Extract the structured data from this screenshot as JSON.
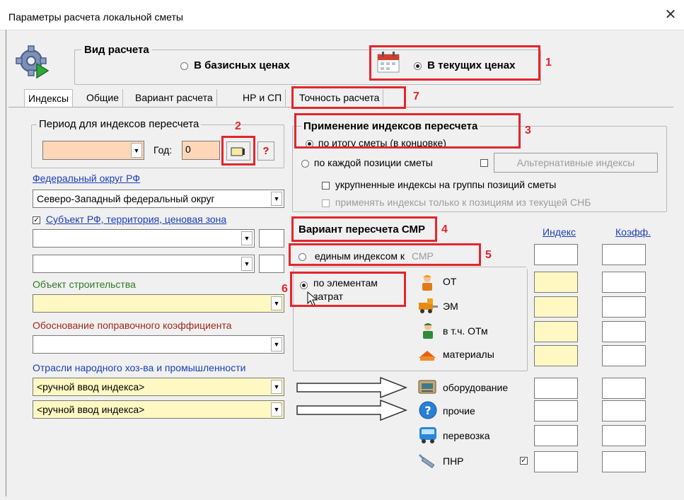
{
  "window": {
    "title": "Параметры расчета локальной сметы",
    "close": "✕"
  },
  "calc_type": {
    "label": "Вид расчета",
    "option_base": "В базисных ценах",
    "option_current": "В текущих ценах",
    "badge": "1"
  },
  "tabs": [
    {
      "label": "Индексы"
    },
    {
      "label": "Общие"
    },
    {
      "label": "Вариант расчета"
    },
    {
      "label": "НР и СП"
    },
    {
      "label": "Точность расчета"
    }
  ],
  "tab_badge": "7",
  "period": {
    "label": "Период для индексов пересчета",
    "year_label": "Год:",
    "year_value": "0",
    "help": "?",
    "badge": "2"
  },
  "federal": {
    "label": "Федеральный округ РФ",
    "value": "Северо-Западный федеральный округ"
  },
  "subject": {
    "label": "Субъект РФ, территория, ценовая зона"
  },
  "object": {
    "label": "Объект строительства"
  },
  "justification": {
    "label": "Обоснование поправочного коэффициента"
  },
  "industries": {
    "label": "Отрасли народного хоз-ва и промышленности",
    "row1": "<ручной ввод индекса>",
    "row2": "<ручной ввод индекса>"
  },
  "apply": {
    "title": "Применение индексов пересчета",
    "opt_total": "по итогу сметы (в концовке)",
    "opt_each": "по каждой позиции сметы",
    "alt_button": "Альтернативные индексы",
    "enlarged": "укрупненные индексы на группы позиций сметы",
    "only_current": "применять индексы только к позициям из текущей СНБ",
    "badge": "3"
  },
  "variant": {
    "title": "Вариант пересчета СМР",
    "badge": "4",
    "col_index": "Индекс",
    "col_coef": "Коэфф.",
    "single": "единым индексом к",
    "single_suffix": "СМР",
    "single_badge": "5",
    "by_elements_1": "по элементам",
    "by_elements_2": "затрат",
    "elements_badge": "6"
  },
  "costs": {
    "ot": "ОТ",
    "em": "ЭМ",
    "otm": "в т.ч. ОТм",
    "materials": "материалы",
    "equipment": "оборудование",
    "other": "прочие",
    "transport": "перевозка",
    "pnr": "ПНР"
  },
  "colors": {
    "red": "#e3262d",
    "link": "#1a3fb8",
    "yellow": "#fff8c2",
    "peach": "#ffd7b8",
    "green_label": "#2f7a1f",
    "brown_label": "#a02a1e"
  }
}
